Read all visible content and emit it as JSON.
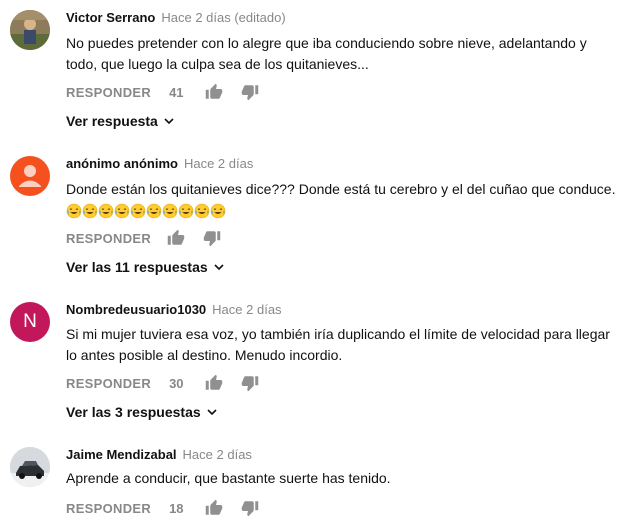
{
  "colors": {
    "orange_avatar": "#f4511e",
    "purple_avatar": "#c2185b",
    "meta_gray": "#888888"
  },
  "comments": [
    {
      "author": "Victor Serrano",
      "time": "Hace 2 días (editado)",
      "text": "No puedes pretender con lo alegre que iba conduciendo sobre nieve, adelantando y todo, que luego la culpa sea de los quitanieves...",
      "reply_label": "RESPONDER",
      "likes": "41",
      "replies_label": "Ver respuesta"
    },
    {
      "author": "anónimo anónimo",
      "time": "Hace 2 días",
      "text": "Donde están los quitanieves dice??? Donde está tu cerebro y el del cuñao que conduce.",
      "emoji_count": 10,
      "emoji_icon": "tears-of-joy-emoji",
      "reply_label": "RESPONDER",
      "likes": "",
      "replies_label": "Ver las 11 respuestas"
    },
    {
      "author": "Nombredeusuario1030",
      "avatar_letter": "N",
      "time": "Hace 2 días",
      "text": "Si mi mujer tuviera esa voz, yo también iría duplicando el límite de velocidad para llegar lo antes posible al destino. Menudo incordio.",
      "reply_label": "RESPONDER",
      "likes": "30",
      "replies_label": "Ver las 3 respuestas"
    },
    {
      "author": "Jaime Mendizabal",
      "time": "Hace 2 días",
      "text": "Aprende a conducir, que bastante suerte has tenido.",
      "reply_label": "RESPONDER",
      "likes": "18"
    }
  ]
}
